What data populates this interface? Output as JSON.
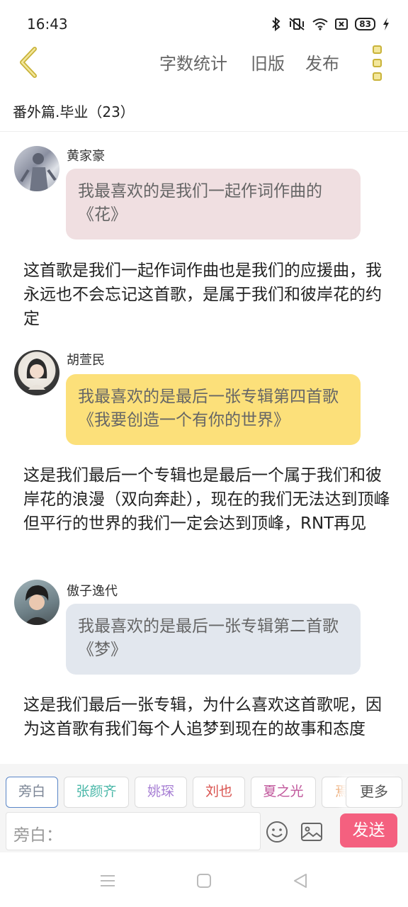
{
  "status_bar": {
    "time": "16:43",
    "battery": "83"
  },
  "top_bar": {
    "word_count_label": "字数统计",
    "old_version_label": "旧版",
    "publish_label": "发布",
    "accent_color": "#c9b33a"
  },
  "chapter": {
    "title": "番外篇.毕业（23）"
  },
  "messages": [
    {
      "speaker": "黄家豪",
      "text": "我最喜欢的是我们一起作词作曲的《花》",
      "bubble_color": "#f0dfe1",
      "narration": "这首歌是我们一起作词作曲也是我们的应援曲，我永远也不会忘记这首歌，是属于我们和彼岸花的约定"
    },
    {
      "speaker": "胡萱民",
      "text": "我最喜欢的是最后一张专辑第四首歌《我要创造一个有你的世界》",
      "bubble_color": "#fce07a",
      "narration": "这是我们最后一个专辑也是最后一个属于我们和彼岸花的浪漫（双向奔赴），现在的我们无法达到顶峰但平行的世界的我们一定会达到顶峰，RNT再见"
    },
    {
      "speaker": "傲子逸代",
      "text": "我最喜欢的是最后一张专辑第二首歌《梦》",
      "bubble_color": "#e2e7ee",
      "narration": "这是我们最后一张专辑，为什么喜欢这首歌呢，因为这首歌有我们每个人追梦到现在的故事和态度"
    }
  ],
  "role_chips": [
    {
      "label": "旁白",
      "color": "#7b8595"
    },
    {
      "label": "张颜齐",
      "color": "#4bb8a9"
    },
    {
      "label": "姚琛",
      "color": "#a77fd4"
    },
    {
      "label": "刘也",
      "color": "#d9534f"
    },
    {
      "label": "夏之光",
      "color": "#c0569b"
    },
    {
      "label": "焉",
      "color": "#e89a5b"
    }
  ],
  "more_label": "更多",
  "input": {
    "placeholder": "旁白："
  },
  "send_label": "发送"
}
